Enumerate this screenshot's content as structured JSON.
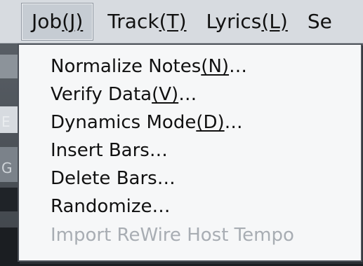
{
  "menubar": {
    "items": [
      {
        "label": "Job",
        "mnemonic": "(J)",
        "active": true
      },
      {
        "label": "Track",
        "mnemonic": "(T)",
        "active": false
      },
      {
        "label": "Lyrics",
        "mnemonic": "(L)",
        "active": false
      },
      {
        "label": "Se",
        "mnemonic": "",
        "active": false
      }
    ]
  },
  "dropdown": {
    "items": [
      {
        "label": "Normalize Notes",
        "mnemonic": "(N)",
        "suffix": "…",
        "enabled": true
      },
      {
        "label": "Verify Data",
        "mnemonic": "(V)",
        "suffix": "…",
        "enabled": true
      },
      {
        "label": "Dynamics Mode",
        "mnemonic": "(D)",
        "suffix": "…",
        "enabled": true
      },
      {
        "label": "Insert Bars",
        "mnemonic": "",
        "suffix": "…",
        "enabled": true
      },
      {
        "label": "Delete Bars",
        "mnemonic": "",
        "suffix": "…",
        "enabled": true
      },
      {
        "label": "Randomize",
        "mnemonic": "",
        "suffix": "…",
        "enabled": true
      },
      {
        "label": "Import ReWire Host Tempo",
        "mnemonic": "",
        "suffix": "",
        "enabled": false
      }
    ]
  },
  "background": {
    "edge_text": [
      "E",
      "G"
    ]
  }
}
